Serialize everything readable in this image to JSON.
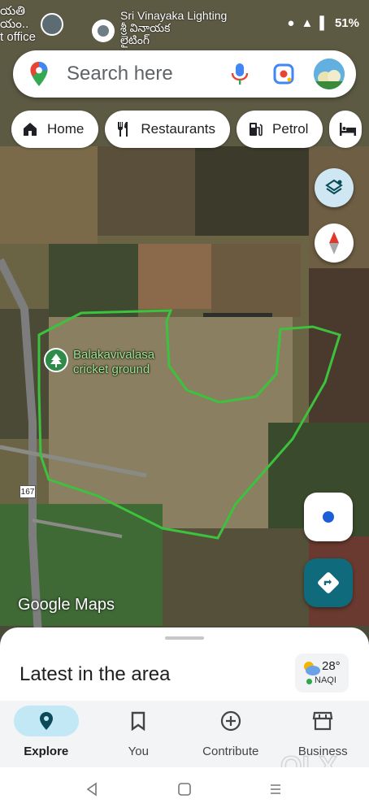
{
  "status_bar": {
    "left_place": "యతి\nయం..\nt office",
    "place_name": "Sri Vinayaka Lighting\nశ్రీ వినాయక\nలైటింగ్",
    "battery": "51%"
  },
  "search": {
    "placeholder": "Search here"
  },
  "chips": [
    {
      "label": "Home",
      "icon": "home-icon"
    },
    {
      "label": "Restaurants",
      "icon": "restaurant-icon"
    },
    {
      "label": "Petrol",
      "icon": "fuel-icon"
    },
    {
      "label": "",
      "icon": "hotel-icon"
    }
  ],
  "map": {
    "poi_label": "Balakavivalasa\ncricket ground",
    "road_number": "167",
    "brand": "Google Maps",
    "boundary_color": "#3cc23c"
  },
  "sheet": {
    "title": "Latest in the area",
    "weather_temp": "28°",
    "aqi_label": "NAQI"
  },
  "nav": [
    {
      "label": "Explore",
      "active": true
    },
    {
      "label": "You",
      "active": false
    },
    {
      "label": "Contribute",
      "active": false
    },
    {
      "label": "Business",
      "active": false
    }
  ],
  "watermark": "OLX",
  "colors": {
    "accent": "#0f6b7b",
    "active_pill": "#c3e8f5"
  }
}
